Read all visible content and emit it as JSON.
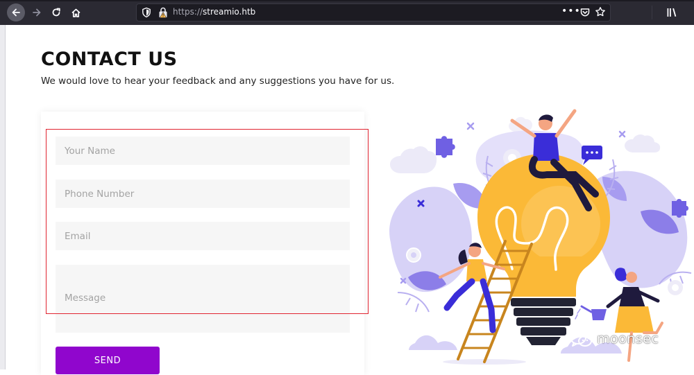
{
  "browser": {
    "url_scheme": "https://",
    "url_host": "streamio.htb",
    "menu_glyph": "•••"
  },
  "page": {
    "title": "CONTACT US",
    "subtitle": "We would love to hear your feedback and any suggestions you have for us."
  },
  "form": {
    "name_placeholder": "Your Name",
    "phone_placeholder": "Phone Number",
    "email_placeholder": "Email",
    "message_placeholder": "Message",
    "send_label": "SEND"
  },
  "watermark": {
    "text": "moonsec"
  },
  "colors": {
    "accent": "#9006cd",
    "highlight_box": "#e0232f",
    "field_bg": "#f6f6f6",
    "bulb": "#fbb937",
    "purple_figure": "#3a2dd8",
    "lavender": "#d7d2f7"
  }
}
